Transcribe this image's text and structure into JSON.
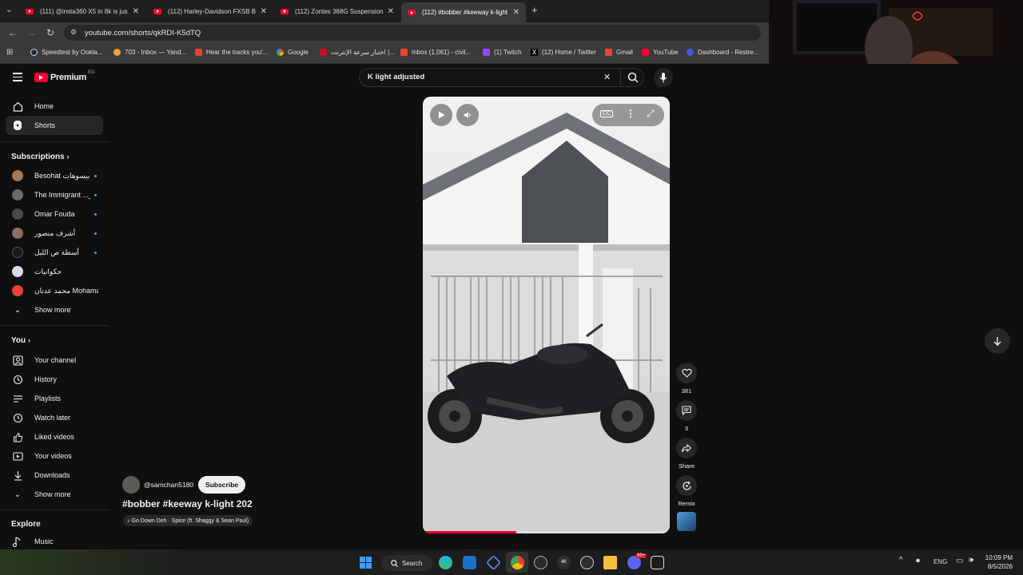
{
  "browser": {
    "tabs": [
      {
        "title": "(111) @insta360 X5 in 8k is just",
        "active": false
      },
      {
        "title": "(112) Harley-Davidson FXSB Bre",
        "active": false
      },
      {
        "title": "(112) Zontes 368G Suspension",
        "active": false
      },
      {
        "title": "(112) #bobber #keeway k-light",
        "active": true
      }
    ],
    "url": "youtube.com/shorts/qkRDI-K5dTQ",
    "bookmarks": [
      "Speedtest by Ookla...",
      "703 - Inbox — Yand...",
      "Hear the tracks you'...",
      "Google",
      "اختبار سرعة الإنترنت |...",
      "Inbox (1,061) - civil...",
      "(1) Twitch",
      "(12) Home / Twitter",
      "Gmail",
      "YouTube",
      "Dashboard - Restre..."
    ]
  },
  "youtube": {
    "logo_text": "Premium",
    "logo_region": "EG",
    "search": {
      "value": "K light adjusted"
    },
    "sidebar": {
      "top": [
        "Home",
        "Shorts"
      ],
      "subscriptions_title": "Subscriptions",
      "subscriptions": [
        "Besohat بيسوهات",
        "The Immigrant ...ـر",
        "Omar Fouda",
        "أشرف منصور",
        "أسطة ص الليل",
        "حکوانیات",
        "محمد عدنان Mohamad..."
      ],
      "subs_show_more": "Show more",
      "you_title": "You",
      "you_items": [
        "Your channel",
        "History",
        "Playlists",
        "Watch later",
        "Liked videos",
        "Your videos",
        "Downloads"
      ],
      "you_show_more": "Show more",
      "explore_title": "Explore",
      "explore_items": [
        "Music"
      ]
    },
    "short": {
      "channel": "@samchan5180",
      "subscribe": "Subscribe",
      "title": "#bobber #keeway k-light 202",
      "music": "Go Down Deh · Spice (ft. Shaggy & Sean Paul)",
      "likes": "381",
      "comments": "3",
      "share": "Share",
      "remix": "Remix",
      "progress": 0.38
    }
  },
  "taskbar": {
    "search_label": "Search",
    "lang": "ENG",
    "time": "10:09 PM",
    "date": "8/5/2026",
    "badge": "99+"
  },
  "colors": {
    "accent": "#ff0033",
    "link": "#3ea6ff"
  }
}
